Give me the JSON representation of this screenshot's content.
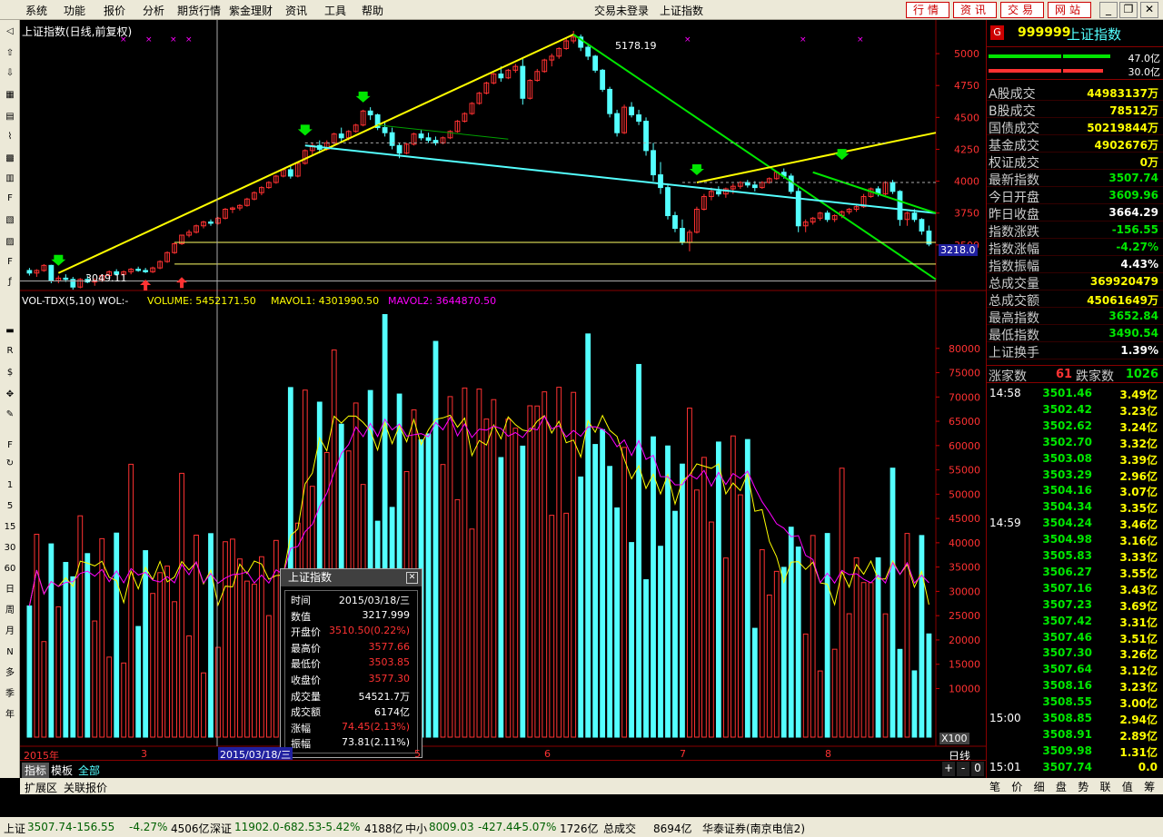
{
  "menu": {
    "items": [
      "系统",
      "功能",
      "报价",
      "分析",
      "期货行情",
      "紫金理财",
      "资讯",
      "工具",
      "帮助"
    ],
    "login_status": "交易未登录",
    "current_view": "上证指数",
    "right_tabs": [
      "行情",
      "资讯",
      "交易",
      "网站"
    ]
  },
  "chart_header": {
    "title": "上证指数(日线,前复权)",
    "high_label": "5178.19",
    "low_label": "3049.11",
    "cursor_price": "3218.0"
  },
  "vol_header": {
    "name": "VOL-TDX(5,10)",
    "wvol": "WOL:-",
    "volume": "VOLUME: 5452171.50",
    "mavol1": "MAVOL1: 4301990.50",
    "mavol2": "MAVOL2: 3644870.50",
    "scale": "X100"
  },
  "date_axis": {
    "labels": [
      "2015年",
      "3",
      "2015/03/18/三",
      "5",
      "6",
      "7",
      "8"
    ],
    "tail": "日线"
  },
  "price_axis": [
    "5000",
    "4750",
    "4500",
    "4250",
    "4000",
    "3750",
    "3500"
  ],
  "vol_axis": [
    "80000",
    "75000",
    "70000",
    "65000",
    "60000",
    "55000",
    "50000",
    "45000",
    "40000",
    "35000",
    "30000",
    "25000",
    "20000",
    "15000",
    "10000"
  ],
  "bottom_tabs": [
    "指标",
    "模板",
    "全部"
  ],
  "bottom_tabs2": [
    "扩展区",
    "关联报价"
  ],
  "zoom_buttons": [
    "+",
    "-",
    "0"
  ],
  "infobox": {
    "title": "上证指数",
    "rows": [
      {
        "label": "时间",
        "value": "2015/03/18/三",
        "color": "#ffffff"
      },
      {
        "label": "数值",
        "value": "3217.999",
        "color": "#ffffff"
      },
      {
        "label": "开盘价",
        "value": "3510.50(0.22%)",
        "color": "#ff3232"
      },
      {
        "label": "最高价",
        "value": "3577.66",
        "color": "#ff3232"
      },
      {
        "label": "最低价",
        "value": "3503.85",
        "color": "#ff3232"
      },
      {
        "label": "收盘价",
        "value": "3577.30",
        "color": "#ff3232"
      },
      {
        "label": "成交量",
        "value": "54521.7万",
        "color": "#ffffff"
      },
      {
        "label": "成交额",
        "value": "6174亿",
        "color": "#ffffff"
      },
      {
        "label": "涨幅",
        "value": "74.45(2.13%)",
        "color": "#ff3232"
      },
      {
        "label": "振幅",
        "value": "73.81(2.11%)",
        "color": "#ffffff"
      }
    ]
  },
  "panel": {
    "code": "999999",
    "name": "上证指数",
    "badge": "G",
    "bar1": "47.0亿",
    "bar2": "30.0亿",
    "stats": [
      {
        "label": "A股成交",
        "value": "44983137万",
        "color": "#ffff00"
      },
      {
        "label": "B股成交",
        "value": "78512万",
        "color": "#ffff00"
      },
      {
        "label": "国债成交",
        "value": "50219844万",
        "color": "#ffff00"
      },
      {
        "label": "基金成交",
        "value": "4902676万",
        "color": "#ffff00"
      },
      {
        "label": "权证成交",
        "value": "0万",
        "color": "#ffff00"
      },
      {
        "label": "最新指数",
        "value": "3507.74",
        "color": "#00e600"
      },
      {
        "label": "今日开盘",
        "value": "3609.96",
        "color": "#00e600"
      },
      {
        "label": "昨日收盘",
        "value": "3664.29",
        "color": "#ffffff"
      },
      {
        "label": "指数涨跌",
        "value": "-156.55",
        "color": "#00e600"
      },
      {
        "label": "指数涨幅",
        "value": "-4.27%",
        "color": "#00e600"
      },
      {
        "label": "指数振幅",
        "value": "4.43%",
        "color": "#ffffff"
      },
      {
        "label": "总成交量",
        "value": "369920479",
        "color": "#ffff00"
      },
      {
        "label": "总成交额",
        "value": "45061649万",
        "color": "#ffff00"
      },
      {
        "label": "最高指数",
        "value": "3652.84",
        "color": "#00e600"
      },
      {
        "label": "最低指数",
        "value": "3490.54",
        "color": "#00e600"
      },
      {
        "label": "上证换手",
        "value": "1.39%",
        "color": "#ffffff"
      }
    ],
    "updown": {
      "up_label": "涨家数",
      "up": "61",
      "down_label": "跌家数",
      "down": "1026"
    },
    "ticks": [
      {
        "t": "14:58",
        "p": "3501.46",
        "v": "3.49亿"
      },
      {
        "t": "",
        "p": "3502.42",
        "v": "3.23亿"
      },
      {
        "t": "",
        "p": "3502.62",
        "v": "3.24亿"
      },
      {
        "t": "",
        "p": "3502.70",
        "v": "3.32亿"
      },
      {
        "t": "",
        "p": "3503.08",
        "v": "3.39亿"
      },
      {
        "t": "",
        "p": "3503.29",
        "v": "2.96亿"
      },
      {
        "t": "",
        "p": "3504.16",
        "v": "3.07亿"
      },
      {
        "t": "",
        "p": "3504.34",
        "v": "3.35亿"
      },
      {
        "t": "14:59",
        "p": "3504.24",
        "v": "3.46亿"
      },
      {
        "t": "",
        "p": "3504.98",
        "v": "3.16亿"
      },
      {
        "t": "",
        "p": "3505.83",
        "v": "3.33亿"
      },
      {
        "t": "",
        "p": "3506.27",
        "v": "3.55亿"
      },
      {
        "t": "",
        "p": "3507.16",
        "v": "3.43亿"
      },
      {
        "t": "",
        "p": "3507.23",
        "v": "3.69亿"
      },
      {
        "t": "",
        "p": "3507.42",
        "v": "3.31亿"
      },
      {
        "t": "",
        "p": "3507.46",
        "v": "3.51亿"
      },
      {
        "t": "",
        "p": "3507.30",
        "v": "3.26亿"
      },
      {
        "t": "",
        "p": "3507.64",
        "v": "3.12亿"
      },
      {
        "t": "",
        "p": "3508.16",
        "v": "3.23亿"
      },
      {
        "t": "",
        "p": "3508.55",
        "v": "3.00亿"
      },
      {
        "t": "15:00",
        "p": "3508.85",
        "v": "2.94亿"
      },
      {
        "t": "",
        "p": "3508.91",
        "v": "2.89亿"
      },
      {
        "t": "",
        "p": "3509.98",
        "v": "1.31亿"
      },
      {
        "t": "15:01",
        "p": "3507.74",
        "v": "0.0"
      }
    ],
    "tabs": [
      "笔",
      "价",
      "细",
      "盘",
      "势",
      "联",
      "值",
      "筹"
    ]
  },
  "status": {
    "sh_label": "上证",
    "sh_price": "3507.74",
    "sh_chg": "-156.55",
    "sh_pct": "-4.27%",
    "sh_amt": "4506亿",
    "sz_label": "深证",
    "sz_price": "11902.0",
    "sz_chg": "-682.53",
    "sz_pct": "-5.42%",
    "sz_amt": "4188亿",
    "zx_label": "中小",
    "zx_price": "8009.03",
    "zx_chg": "-427.44",
    "zx_pct": "-5.07%",
    "zx_amt": "1726亿",
    "total_label": "总成交",
    "total": "8694亿",
    "broker": "华泰证券(南京电信2)"
  },
  "colors": {
    "up": "#ff3232",
    "down": "#54ffff",
    "ma5": "#ffff00",
    "ma10": "#ff00ff"
  },
  "chart_data": {
    "type": "candlestick",
    "title": "上证指数(日线,前复权)",
    "price_ylim": [
      3200,
      5150
    ],
    "price_ticks": [
      3500,
      3750,
      4000,
      4250,
      4500,
      4750,
      5000
    ],
    "candles": [
      [
        3300,
        3320,
        3260,
        3280
      ],
      [
        3280,
        3310,
        3250,
        3300
      ],
      [
        3300,
        3350,
        3290,
        3340
      ],
      [
        3340,
        3345,
        3200,
        3220
      ],
      [
        3220,
        3260,
        3200,
        3240
      ],
      [
        3240,
        3270,
        3210,
        3230
      ],
      [
        3230,
        3250,
        3150,
        3170
      ],
      [
        3170,
        3240,
        3160,
        3230
      ],
      [
        3230,
        3260,
        3200,
        3210
      ],
      [
        3210,
        3240,
        3180,
        3220
      ],
      [
        3220,
        3270,
        3210,
        3260
      ],
      [
        3260,
        3300,
        3250,
        3290
      ],
      [
        3290,
        3310,
        3260,
        3270
      ],
      [
        3270,
        3300,
        3250,
        3290
      ],
      [
        3290,
        3320,
        3270,
        3310
      ],
      [
        3310,
        3330,
        3290,
        3300
      ],
      [
        3300,
        3320,
        3280,
        3290
      ],
      [
        3290,
        3330,
        3280,
        3320
      ],
      [
        3320,
        3380,
        3310,
        3370
      ],
      [
        3370,
        3450,
        3360,
        3440
      ],
      [
        3440,
        3520,
        3430,
        3510
      ],
      [
        3510,
        3580,
        3500,
        3577
      ],
      [
        3577,
        3620,
        3560,
        3600
      ],
      [
        3600,
        3660,
        3590,
        3650
      ],
      [
        3650,
        3690,
        3630,
        3680
      ],
      [
        3680,
        3700,
        3650,
        3670
      ],
      [
        3670,
        3720,
        3660,
        3710
      ],
      [
        3710,
        3790,
        3700,
        3780
      ],
      [
        3780,
        3800,
        3750,
        3790
      ],
      [
        3790,
        3820,
        3770,
        3810
      ],
      [
        3810,
        3870,
        3800,
        3860
      ],
      [
        3860,
        3920,
        3850,
        3910
      ],
      [
        3910,
        3960,
        3890,
        3950
      ],
      [
        3950,
        4000,
        3940,
        3990
      ],
      [
        3990,
        4050,
        3980,
        4040
      ],
      [
        4040,
        4100,
        4030,
        4090
      ],
      [
        4090,
        4120,
        4020,
        4040
      ],
      [
        4040,
        4150,
        4030,
        4140
      ],
      [
        4140,
        4250,
        4130,
        4240
      ],
      [
        4240,
        4300,
        4200,
        4280
      ],
      [
        4280,
        4320,
        4220,
        4250
      ],
      [
        4250,
        4320,
        4240,
        4300
      ],
      [
        4300,
        4380,
        4290,
        4370
      ],
      [
        4370,
        4420,
        4300,
        4340
      ],
      [
        4340,
        4400,
        4320,
        4390
      ],
      [
        4390,
        4450,
        4380,
        4440
      ],
      [
        4440,
        4560,
        4430,
        4550
      ],
      [
        4550,
        4580,
        4480,
        4520
      ],
      [
        4520,
        4530,
        4400,
        4420
      ],
      [
        4420,
        4460,
        4350,
        4380
      ],
      [
        4380,
        4420,
        4250,
        4280
      ],
      [
        4280,
        4300,
        4180,
        4220
      ],
      [
        4220,
        4300,
        4210,
        4290
      ],
      [
        4290,
        4380,
        4280,
        4370
      ],
      [
        4370,
        4400,
        4320,
        4340
      ],
      [
        4340,
        4380,
        4300,
        4320
      ],
      [
        4320,
        4350,
        4280,
        4300
      ],
      [
        4300,
        4350,
        4290,
        4340
      ],
      [
        4340,
        4400,
        4330,
        4390
      ],
      [
        4390,
        4480,
        4380,
        4470
      ],
      [
        4470,
        4540,
        4460,
        4530
      ],
      [
        4530,
        4620,
        4520,
        4610
      ],
      [
        4610,
        4700,
        4600,
        4690
      ],
      [
        4690,
        4780,
        4680,
        4770
      ],
      [
        4770,
        4850,
        4760,
        4840
      ],
      [
        4840,
        4900,
        4780,
        4810
      ],
      [
        4810,
        4880,
        4800,
        4870
      ],
      [
        4870,
        4920,
        4850,
        4900
      ],
      [
        4900,
        4960,
        4600,
        4650
      ],
      [
        4650,
        4800,
        4640,
        4790
      ],
      [
        4790,
        4880,
        4780,
        4860
      ],
      [
        4860,
        4960,
        4850,
        4950
      ],
      [
        4950,
        5000,
        4900,
        4980
      ],
      [
        4980,
        5050,
        4960,
        5040
      ],
      [
        5040,
        5120,
        5030,
        5100
      ],
      [
        5100,
        5178,
        5080,
        5130
      ],
      [
        5130,
        5150,
        5020,
        5050
      ],
      [
        5050,
        5080,
        4950,
        4980
      ],
      [
        4980,
        4990,
        4850,
        4870
      ],
      [
        4870,
        4880,
        4700,
        4720
      ],
      [
        4720,
        4740,
        4500,
        4530
      ],
      [
        4530,
        4560,
        4350,
        4380
      ],
      [
        4380,
        4600,
        4370,
        4580
      ],
      [
        4580,
        4620,
        4500,
        4520
      ],
      [
        4520,
        4560,
        4440,
        4470
      ],
      [
        4470,
        4500,
        4200,
        4240
      ],
      [
        4240,
        4300,
        4000,
        4050
      ],
      [
        4050,
        4150,
        3900,
        3950
      ],
      [
        3950,
        3980,
        3700,
        3730
      ],
      [
        3730,
        3760,
        3600,
        3630
      ],
      [
        3630,
        3700,
        3500,
        3520
      ],
      [
        3520,
        3620,
        3450,
        3600
      ],
      [
        3600,
        3800,
        3590,
        3780
      ],
      [
        3780,
        3900,
        3770,
        3880
      ],
      [
        3880,
        3950,
        3850,
        3920
      ],
      [
        3920,
        3960,
        3880,
        3900
      ],
      [
        3900,
        3950,
        3870,
        3940
      ],
      [
        3940,
        3980,
        3900,
        3960
      ],
      [
        3960,
        4000,
        3940,
        3990
      ],
      [
        3990,
        4010,
        3950,
        3970
      ],
      [
        3970,
        4000,
        3920,
        3950
      ],
      [
        3950,
        4000,
        3940,
        3990
      ],
      [
        3990,
        4030,
        3980,
        4020
      ],
      [
        4020,
        4080,
        4010,
        4070
      ],
      [
        4070,
        4100,
        4020,
        4040
      ],
      [
        4040,
        4060,
        3900,
        3920
      ],
      [
        3920,
        3950,
        3600,
        3650
      ],
      [
        3650,
        3700,
        3600,
        3680
      ],
      [
        3680,
        3720,
        3660,
        3710
      ],
      [
        3710,
        3760,
        3690,
        3750
      ],
      [
        3750,
        3770,
        3680,
        3700
      ],
      [
        3700,
        3740,
        3680,
        3730
      ],
      [
        3730,
        3770,
        3710,
        3760
      ],
      [
        3760,
        3790,
        3740,
        3780
      ],
      [
        3780,
        3820,
        3760,
        3800
      ],
      [
        3800,
        3900,
        3790,
        3880
      ],
      [
        3880,
        3950,
        3870,
        3940
      ],
      [
        3940,
        3960,
        3880,
        3900
      ],
      [
        3900,
        4000,
        3890,
        3990
      ],
      [
        3990,
        4010,
        3900,
        3920
      ],
      [
        3920,
        3930,
        3650,
        3700
      ],
      [
        3700,
        3760,
        3650,
        3750
      ],
      [
        3750,
        3780,
        3680,
        3700
      ],
      [
        3700,
        3710,
        3580,
        3609
      ],
      [
        3609,
        3652,
        3490,
        3507
      ]
    ],
    "volumes": []
  }
}
